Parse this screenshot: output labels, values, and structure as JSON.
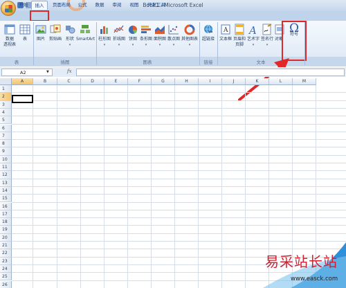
{
  "window": {
    "title": "Book1 - Microsoft Excel"
  },
  "tabs": [
    {
      "label": "开始",
      "active": false
    },
    {
      "label": "插入",
      "active": true
    },
    {
      "label": "页面布局",
      "active": false
    },
    {
      "label": "公式",
      "active": false
    },
    {
      "label": "数据",
      "active": false
    },
    {
      "label": "审阅",
      "active": false
    },
    {
      "label": "视图",
      "active": false
    },
    {
      "label": "开发工具",
      "active": false
    }
  ],
  "ribbon": {
    "groups": {
      "table": "表",
      "illustrations": "插图",
      "charts": "图表",
      "links": "链接",
      "text": "文本"
    },
    "buttons": {
      "pivot_line1": "数据",
      "pivot_line2": "透视表",
      "table": "表",
      "picture": "图片",
      "clipart": "剪贴画",
      "shapes": "形状",
      "smartart": "SmartArt",
      "column": "柱形图",
      "line": "折线图",
      "pie": "饼图",
      "bar": "条形图",
      "area": "面积图",
      "scatter": "散点图",
      "other_charts": "其他图表",
      "hyperlink": "超链接",
      "textbox": "文本框",
      "header_footer_line1": "页眉和",
      "header_footer_line2": "页脚",
      "wordart": "艺术字",
      "signature": "签名行",
      "object": "对象",
      "symbol_glyph": "Ω",
      "symbol": "符号"
    }
  },
  "formula_bar": {
    "name_box": "A2",
    "fx": "fx",
    "value": ""
  },
  "grid": {
    "columns": [
      "A",
      "B",
      "C",
      "D",
      "E",
      "F",
      "G",
      "H",
      "I",
      "J",
      "K",
      "L",
      "M"
    ],
    "rows": [
      "1",
      "2",
      "3",
      "4",
      "5",
      "6",
      "7",
      "8",
      "9",
      "10",
      "11",
      "12",
      "13",
      "14",
      "15",
      "16",
      "17",
      "18",
      "19",
      "20",
      "21",
      "22",
      "23",
      "24",
      "25",
      "26"
    ],
    "selected_column": "A",
    "selected_row": "2"
  },
  "watermark": {
    "text": "易采站长站",
    "url": "www.easck.com"
  },
  "colors": {
    "highlight": "#e02828",
    "accent": "#2a5aa5"
  }
}
